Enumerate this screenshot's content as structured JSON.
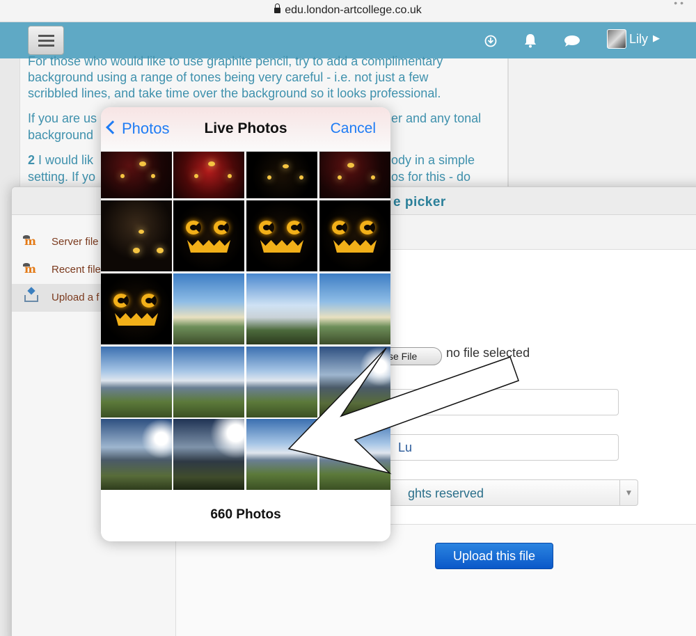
{
  "browser": {
    "url": "edu.london-artcollege.co.uk"
  },
  "navbar": {
    "menu_icon": "hamburger-menu-icon",
    "icons": [
      "download-arrow-icon",
      "bell-icon",
      "chat-bubble-icon"
    ],
    "user_name": "Lily"
  },
  "page": {
    "paragraphs": [
      "For those who would like to use graphite pencil, try to add a complimentary",
      "background using a range of tones being very careful - i.e. not just a few",
      "scribbled lines, and take time over the background so it looks professional.",
      "If you are us",
      "er and any tonal",
      "background",
      "2 I would lik",
      "ody in a simple",
      "setting. If yo",
      "os for this - do"
    ]
  },
  "file_picker": {
    "title": "e picker",
    "repositories": [
      {
        "label": "Server file",
        "icon": "moodle-icon"
      },
      {
        "label": "Recent file",
        "icon": "moodle-icon"
      },
      {
        "label": "Upload a f",
        "icon": "upload-icon"
      }
    ],
    "choose_file_label": "se File",
    "no_file_text": "no file selected",
    "author_value": "Lu",
    "license_value": "ghts reserved",
    "upload_button": "Upload this file"
  },
  "photo_picker": {
    "back_label": "Photos",
    "title": "Live Photos",
    "cancel_label": "Cancel",
    "footer_count": "660 Photos",
    "thumbnails": [
      "halloween-room-dark",
      "halloween-room-red",
      "halloween-room-dark",
      "halloween-room-red",
      "halloween-room-dark",
      "jack-o-lantern",
      "jack-o-lantern",
      "jack-o-lantern",
      "jack-o-lantern",
      "beach-trees",
      "beach-trees",
      "beach-trees",
      "coast-sea",
      "coast-sea",
      "coast-sea",
      "coast-sun",
      "coast-sun",
      "coast-sun",
      "coast-sea",
      "coast-sea"
    ]
  },
  "colors": {
    "navbar": "#5fa9c5",
    "link_text": "#3f91ad",
    "ios_accent": "#1f7cf4",
    "upload_button": "#0a58c9"
  }
}
